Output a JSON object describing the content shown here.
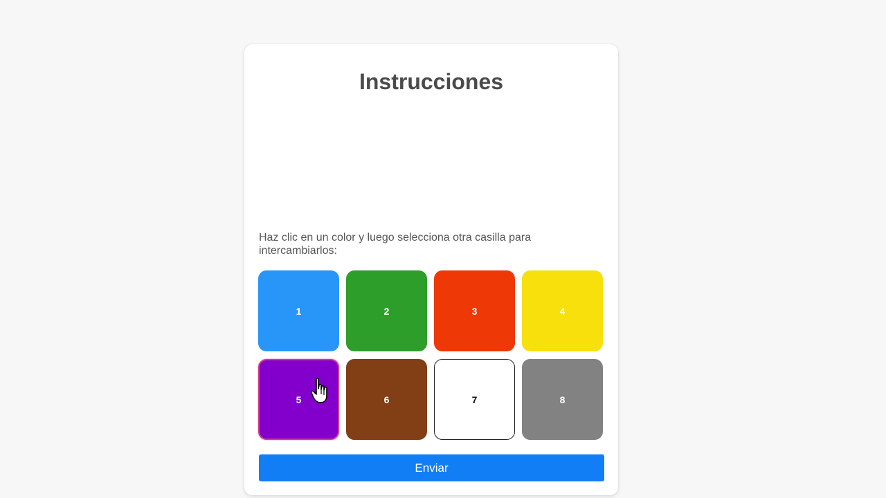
{
  "page": {
    "title": "Instrucciones",
    "instructions": "Haz clic en un color y luego selecciona otra casilla para intercambiarlos:",
    "submit_label": "Enviar"
  },
  "tiles": [
    {
      "label": "1",
      "color": "#2896f8",
      "selected": false
    },
    {
      "label": "2",
      "color": "#2c9e29",
      "selected": false
    },
    {
      "label": "3",
      "color": "#ee3805",
      "selected": false
    },
    {
      "label": "4",
      "color": "#f7e00c",
      "selected": false
    },
    {
      "label": "5",
      "color": "#8300cc",
      "selected": true
    },
    {
      "label": "6",
      "color": "#823f16",
      "selected": false
    },
    {
      "label": "7",
      "color": "#ffffff",
      "selected": false
    },
    {
      "label": "8",
      "color": "#828282",
      "selected": false
    }
  ],
  "colors": {
    "background": "#f7f7f7",
    "card": "#ffffff",
    "button": "#127ef5",
    "selected_border": "#d63a8a"
  },
  "cursor": {
    "icon": "hand-pointer-icon"
  }
}
